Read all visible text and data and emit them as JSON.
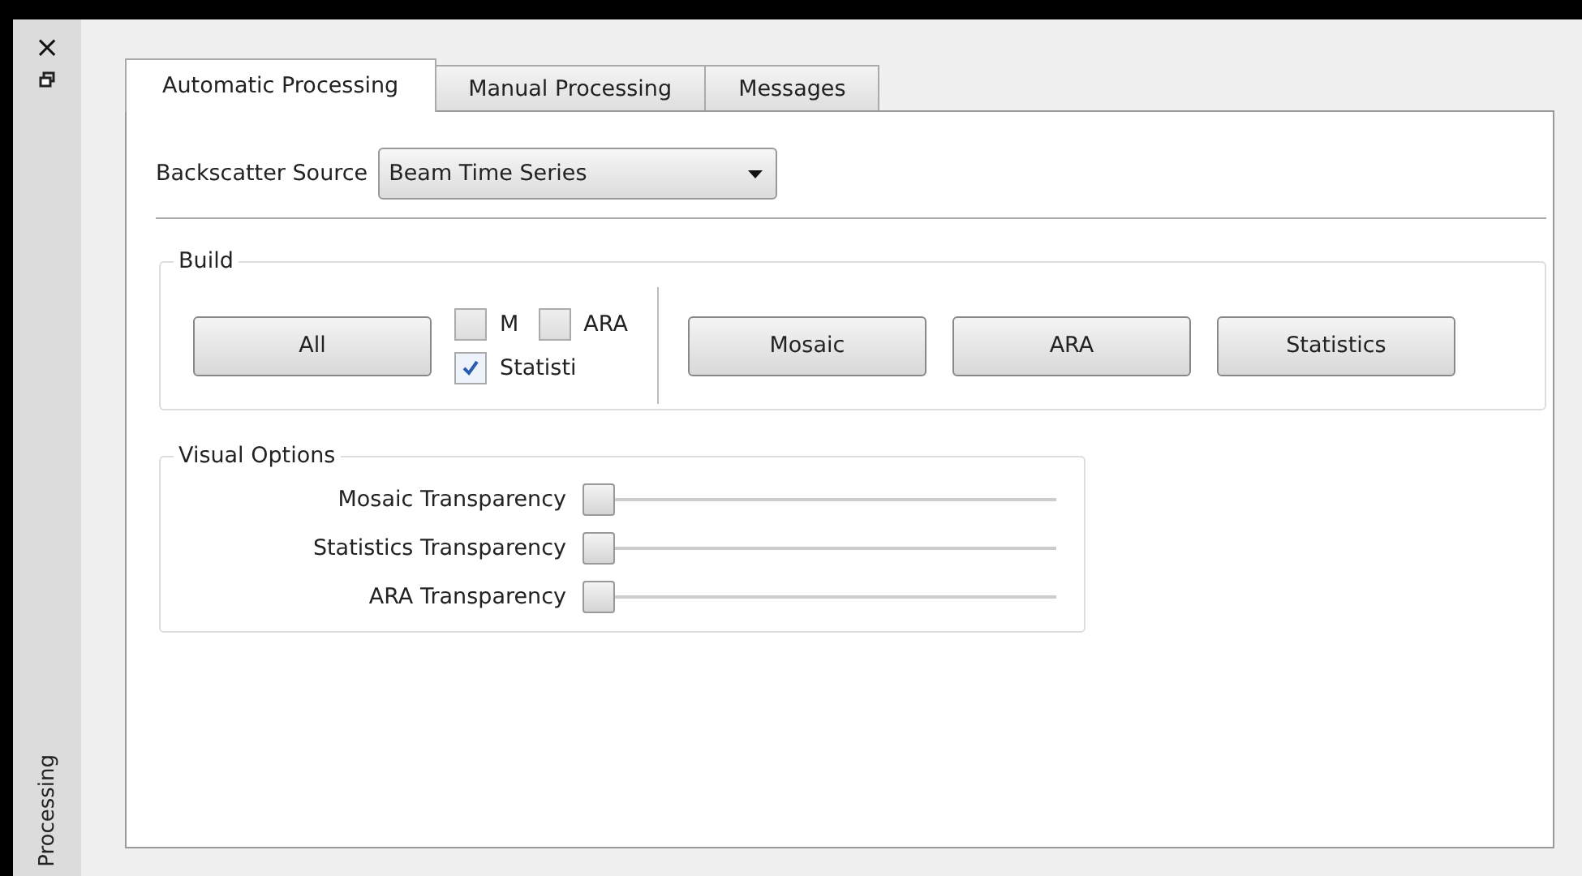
{
  "dock": {
    "title": "Processing",
    "close_glyph": "×"
  },
  "tabs": [
    {
      "label": "Automatic Processing",
      "selected": true
    },
    {
      "label": "Manual Processing",
      "selected": false
    },
    {
      "label": "Messages",
      "selected": false
    }
  ],
  "backscatter_source": {
    "label": "Backscatter Source",
    "value": "Beam Time Series"
  },
  "build": {
    "title": "Build",
    "all_button": "All",
    "checkboxes": [
      {
        "label": "M",
        "checked": false
      },
      {
        "label": "ARA",
        "checked": false
      },
      {
        "label": "Statisti",
        "checked": true
      }
    ],
    "buttons": [
      "Mosaic",
      "ARA",
      "Statistics"
    ]
  },
  "visual_options": {
    "title": "Visual Options",
    "sliders": [
      {
        "label": "Mosaic Transparency",
        "level": 0
      },
      {
        "label": "Statistics Transparency",
        "level": 0
      },
      {
        "label": "ARA Transparency",
        "level": 0
      }
    ]
  }
}
